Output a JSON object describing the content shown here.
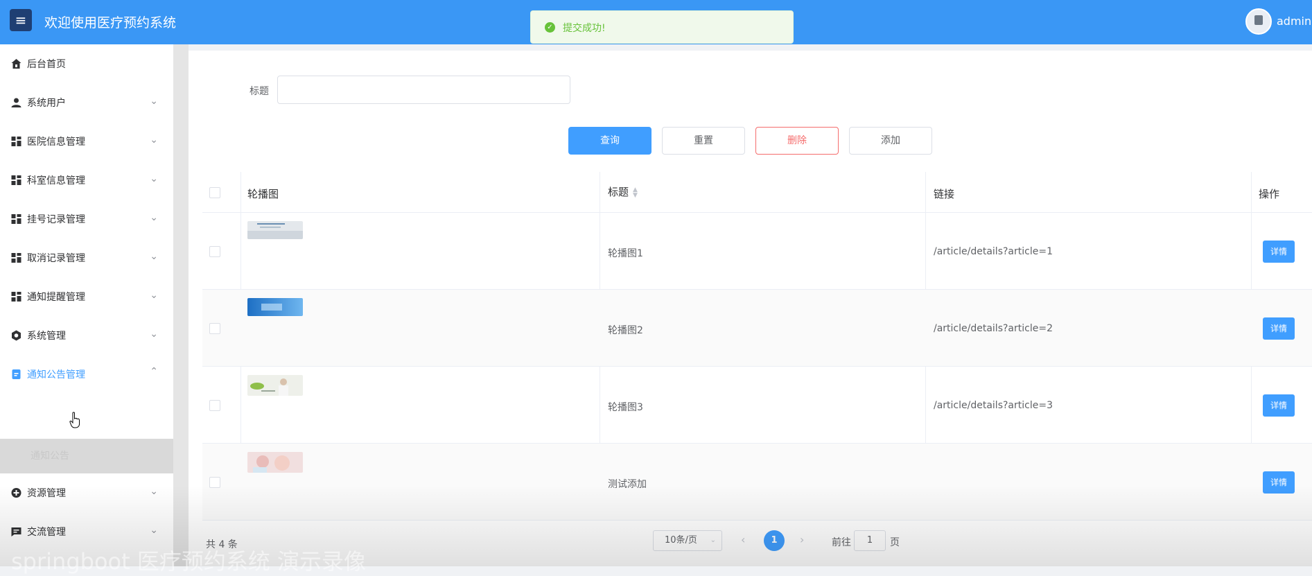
{
  "header": {
    "menu_icon": "hamburger-icon",
    "title": "欢迎使用医疗预约系统",
    "user": "admin",
    "bg_color": "#3a97f5"
  },
  "toast": {
    "text": "提交成功!",
    "icon": "success-check-icon",
    "color": "#67c23a"
  },
  "sidebar": {
    "items": [
      {
        "label": "后台首页",
        "icon": "home-icon"
      },
      {
        "label": "系统用户",
        "icon": "user-icon",
        "expandable": true
      },
      {
        "label": "医院信息管理",
        "icon": "grid-icon",
        "expandable": true
      },
      {
        "label": "科室信息管理",
        "icon": "grid-icon",
        "expandable": true
      },
      {
        "label": "挂号记录管理",
        "icon": "grid-icon",
        "expandable": true
      },
      {
        "label": "取消记录管理",
        "icon": "grid-icon",
        "expandable": true
      },
      {
        "label": "通知提醒管理",
        "icon": "grid-icon",
        "expandable": true
      },
      {
        "label": "系统管理",
        "icon": "gear-icon",
        "expandable": true
      },
      {
        "label": "通知公告管理",
        "icon": "document-icon",
        "expandable": true,
        "active": true
      },
      {
        "label": "资源管理",
        "icon": "plus-circle-icon",
        "expandable": true
      },
      {
        "label": "交流管理",
        "icon": "chat-icon",
        "expandable": true
      }
    ],
    "sub_item": "通知公告"
  },
  "search": {
    "label": "标题",
    "value": ""
  },
  "buttons": {
    "query": "查询",
    "reset": "重置",
    "delete": "删除",
    "add": "添加"
  },
  "table": {
    "headers": {
      "image": "轮播图",
      "title": "标题",
      "link": "链接",
      "action": "操作"
    },
    "rows": [
      {
        "title": "轮播图1",
        "link": "/article/details?article=1",
        "action": "详情"
      },
      {
        "title": "轮播图2",
        "link": "/article/details?article=2",
        "action": "详情"
      },
      {
        "title": "轮播图3",
        "link": "/article/details?article=3",
        "action": "详情"
      },
      {
        "title": "测试添加",
        "link": "",
        "action": "详情"
      }
    ]
  },
  "pagination": {
    "total": "共 4 条",
    "page_size": "10条/页",
    "current_page": "1",
    "goto_prefix": "前往",
    "goto_value": "1",
    "goto_suffix": "页"
  },
  "watermark": "springboot 医疗预约系统 演示录像"
}
